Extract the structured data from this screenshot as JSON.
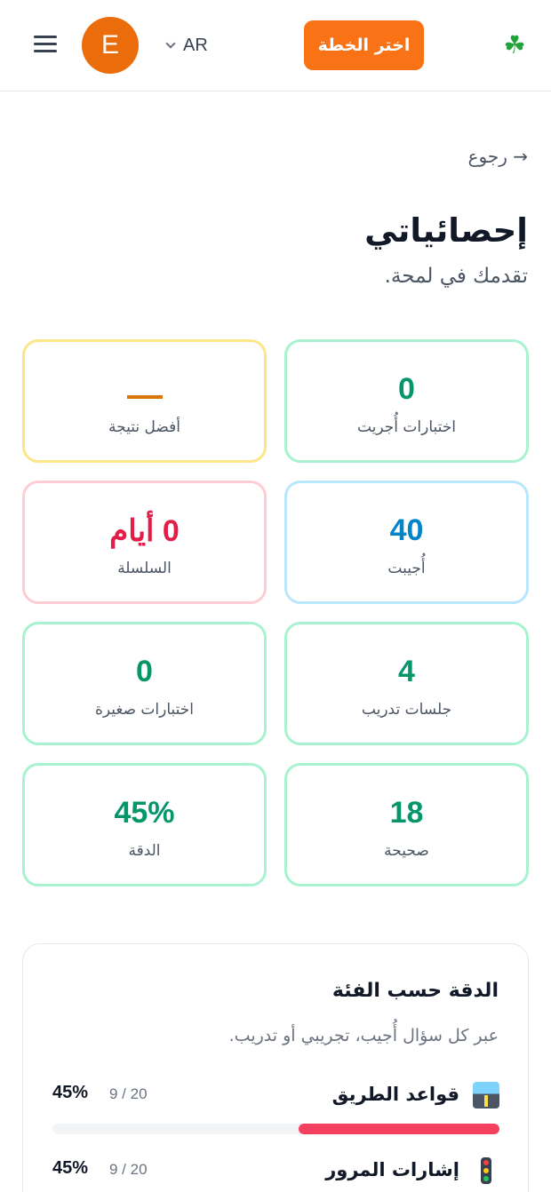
{
  "header": {
    "avatar_letter": "E",
    "language": "AR",
    "plan_button": "اختر الخطة",
    "logo_icon": "clover-icon"
  },
  "nav": {
    "back_label": "→ رجوع"
  },
  "page": {
    "title": "إحصائياتي",
    "subtitle": "تقدمك في لمحة."
  },
  "stats": {
    "tests_taken": {
      "value": "0",
      "label": "اختبارات أُجريت"
    },
    "best_score": {
      "value": "",
      "label": "أفضل نتيجة"
    },
    "answered": {
      "value": "40",
      "label": "أُجيبت"
    },
    "streak": {
      "value": "0 أيام",
      "label": "السلسلة"
    },
    "practice_sessions": {
      "value": "4",
      "label": "جلسات تدريب"
    },
    "mini_tests": {
      "value": "0",
      "label": "اختبارات صغيرة"
    },
    "correct": {
      "value": "18",
      "label": "صحيحة"
    },
    "accuracy": {
      "value": "45%",
      "label": "الدقة"
    }
  },
  "accuracy_by_category": {
    "title": "الدقة حسب الفئة",
    "subtitle": "عبر كل سؤال أُجيب، تجريبي أو تدريب.",
    "items": [
      {
        "name": "قواعد الطريق",
        "count": "9 / 20",
        "percent": "45%",
        "fraction": 0.45,
        "icon": "road-icon"
      },
      {
        "name": "إشارات المرور",
        "count": "9 / 20",
        "percent": "45%",
        "fraction": 0.45,
        "icon": "traffic-light-icon"
      }
    ]
  },
  "colors": {
    "accent": "#f97316",
    "green": "#059669",
    "blue": "#0284c7",
    "red": "#e11d48",
    "bar_fill": "#f43f5e"
  }
}
